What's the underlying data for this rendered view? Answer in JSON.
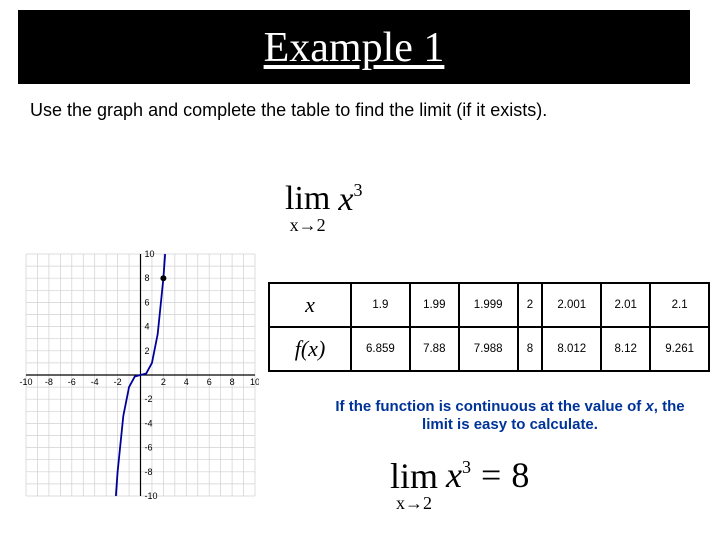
{
  "title": "Example 1",
  "instruction": "Use the graph and complete the table to find the limit (if it exists).",
  "limit1": {
    "lim": "lim",
    "sub": "x→2",
    "arg_var": "x",
    "arg_exp": "3"
  },
  "table": {
    "row_x_label": "x",
    "row_fx_label": "f(x)",
    "x_vals": [
      "1.9",
      "1.99",
      "1.999",
      "2",
      "2.001",
      "2.01",
      "2.1"
    ],
    "fx_vals": [
      "6.859",
      "7.88",
      "7.988",
      "8",
      "8.012",
      "8.12",
      "9.261"
    ]
  },
  "note_prefix": "If the function is continuous at the value of ",
  "note_var": "x",
  "note_suffix": ", the limit is easy to calculate.",
  "limit2": {
    "lim": "lim",
    "sub": "x→2",
    "arg_var": "x",
    "arg_exp": "3",
    "eq": "=",
    "ans": "8"
  },
  "chart_data": {
    "type": "line",
    "title": "",
    "xlabel": "",
    "ylabel": "",
    "xlim": [
      -10,
      10
    ],
    "ylim": [
      -10,
      10
    ],
    "x_ticks": [
      -10,
      -8,
      -6,
      -4,
      -2,
      2,
      4,
      6,
      8,
      10
    ],
    "y_ticks": [
      -10,
      -8,
      -6,
      -4,
      -2,
      2,
      4,
      6,
      8,
      10
    ],
    "grid": true,
    "series": [
      {
        "name": "f(x)=x^3",
        "color": "#000099",
        "x": [
          -2.15,
          -2.0,
          -1.5,
          -1.0,
          -0.5,
          0.0,
          0.5,
          1.0,
          1.5,
          2.0,
          2.15
        ],
        "y": [
          -10,
          -8.0,
          -3.375,
          -1.0,
          -0.125,
          0.0,
          0.125,
          1.0,
          3.375,
          8.0,
          10
        ]
      }
    ],
    "annotations": [
      {
        "type": "point",
        "x": 2,
        "y": 8,
        "fill": "#000"
      }
    ]
  }
}
